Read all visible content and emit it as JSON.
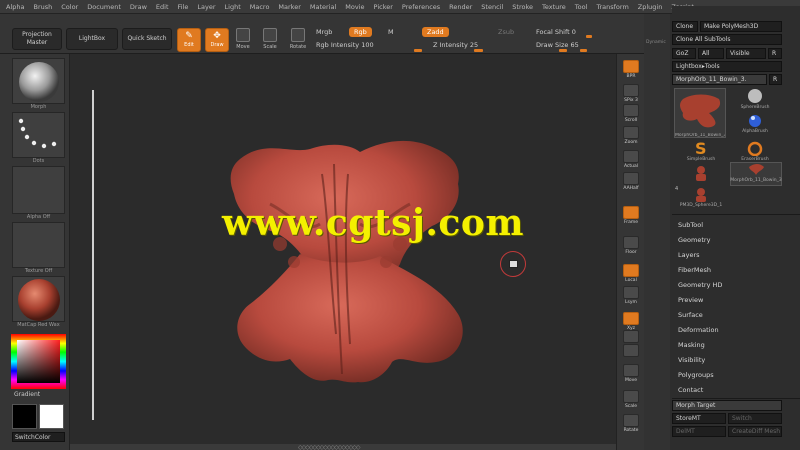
{
  "menubar": {
    "items": [
      "Alpha",
      "Brush",
      "Color",
      "Document",
      "Draw",
      "Edit",
      "File",
      "Layer",
      "Light",
      "Macro",
      "Marker",
      "Material",
      "Movie",
      "Picker",
      "Preferences",
      "Render",
      "Stencil",
      "Stroke",
      "Texture",
      "Tool",
      "Transform",
      "Zplugin",
      "Zscript"
    ]
  },
  "topshelf": {
    "projection_master": "Projection Master",
    "lightbox": "LightBox",
    "quick_sketch": "Quick Sketch",
    "edit": "Edit",
    "draw": "Draw",
    "move": "Move",
    "scale": "Scale",
    "rotate": "Rotate",
    "mrgb": "Mrgb",
    "rgb": "Rgb",
    "m": "M",
    "zadd": "Zadd",
    "zsub": "Zsub",
    "rgb_intensity": "Rgb Intensity 100",
    "z_intensity": "Z Intensity 25",
    "focal_shift": "Focal Shift 0",
    "draw_size": "Draw Size 65"
  },
  "leftshelf": {
    "brush_label": "Morph",
    "stroke_label": "Dots",
    "alpha_label": "Alpha Off",
    "texture_label": "Texture Off",
    "material_label": "MatCap Red Wax",
    "gradient_label": "Gradient",
    "switch_color": "SwitchColor"
  },
  "canvas": {
    "watermark": "www.cgtsj.com"
  },
  "rightshelf": {
    "items": [
      "BPR",
      "SPix 3",
      "Scroll",
      "Zoom",
      "Actual",
      "AAHalf",
      "Frame",
      "Floor",
      "Local",
      "Lsym",
      "Xyz",
      "",
      "",
      "Move",
      "Scale",
      "Rotate"
    ]
  },
  "tray": {
    "label": "Dynamic",
    "buttons": {
      "clone": "Clone",
      "make_polymesh": "Make PolyMesh3D",
      "clone_all": "Clone All SubTools",
      "goz": "GoZ",
      "all": "All",
      "visible": "Visible",
      "r": "R",
      "lightbox_tools": "Lightbox▸Tools",
      "current_tool": "MorphOrb_11_Bowin_3.",
      "r2": "R"
    },
    "tools": [
      "MorphOrb_11_Bowin_3",
      "SphereBrush",
      "AlphaBrush",
      "SimpleBrush",
      "EraserBrush",
      "MorphOrb_11_Bowin_3",
      "PM3D_Sphere3D_1"
    ],
    "tool_count": "4",
    "menus": [
      "SubTool",
      "Geometry",
      "Layers",
      "FiberMesh",
      "Geometry HD",
      "Preview",
      "Surface",
      "Deformation",
      "Masking",
      "Visibility",
      "Polygroups",
      "Contact",
      "Morph Target"
    ],
    "morph": {
      "store": "StoreMT",
      "switch": "Switch",
      "delete": "DelMT",
      "create_diff": "CreateDiff Mesh"
    }
  },
  "colors": {
    "accent": "#e07a20",
    "model": "#b84a3e",
    "watermark": "#f4f000"
  }
}
